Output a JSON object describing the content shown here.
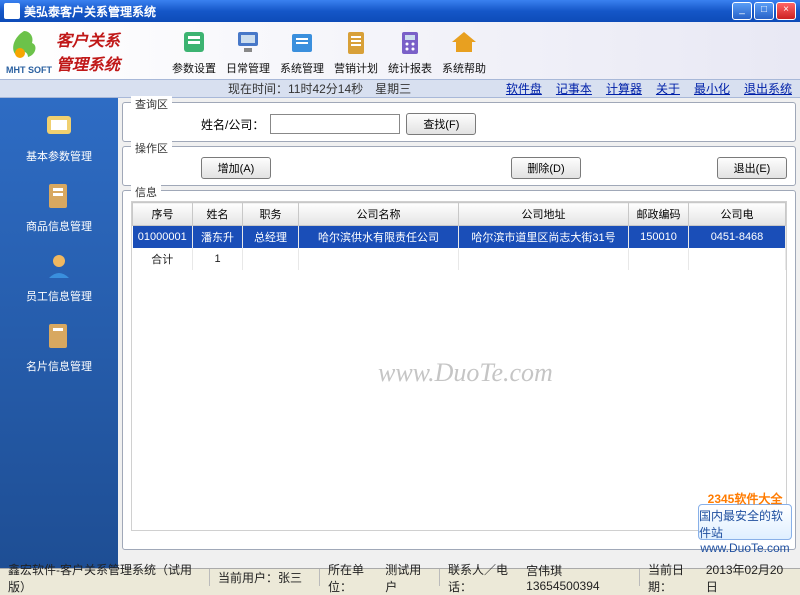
{
  "window": {
    "title": "美弘泰客户关系管理系统"
  },
  "brand": {
    "logotext": "MHT SOFT",
    "line1": "客户关系",
    "line2": "管理系统"
  },
  "ribbon": [
    {
      "label": "参数设置"
    },
    {
      "label": "日常管理"
    },
    {
      "label": "系统管理"
    },
    {
      "label": "营销计划"
    },
    {
      "label": "统计报表"
    },
    {
      "label": "系统帮助"
    }
  ],
  "subbar": {
    "time": "现在时间：11时42分14秒　星期三",
    "links": [
      "软件盘",
      "记事本",
      "计算器",
      "关于",
      "最小化",
      "退出系统"
    ]
  },
  "sidebar": [
    {
      "label": "基本参数管理"
    },
    {
      "label": "商品信息管理"
    },
    {
      "label": "员工信息管理"
    },
    {
      "label": "名片信息管理"
    }
  ],
  "groups": {
    "query": {
      "legend": "查询区",
      "label": "姓名/公司：",
      "value": "",
      "find": "查找(F)"
    },
    "actions": {
      "legend": "操作区",
      "add": "增加(A)",
      "del": "删除(D)",
      "exit": "退出(E)"
    },
    "info": {
      "legend": "信息"
    }
  },
  "table": {
    "headers": [
      "序号",
      "姓名",
      "职务",
      "公司名称",
      "公司地址",
      "邮政编码",
      "公司电"
    ],
    "rows": [
      {
        "cells": [
          "01000001",
          "潘东升",
          "总经理",
          "哈尔滨供水有限责任公司",
          "哈尔滨市道里区尚志大街31号",
          "150010",
          "0451-8468"
        ]
      }
    ],
    "total": {
      "label": "合计",
      "count": "1"
    }
  },
  "watermark": "www.DuoTe.com",
  "badge": {
    "brand": "2345软件大全",
    "slogan": "国内最安全的软件站",
    "url": "www.DuoTe.com"
  },
  "statusbar": {
    "product": "鑫宏软件-客户关系管理系统（试用版）",
    "user_label": "当前用户：",
    "user": "张三",
    "org_label": "所在单位：",
    "org": "测试用户",
    "contact_label": "联系人／电话：",
    "contact": "宫伟琪  13654500394",
    "date_label": "当前日期：",
    "date": "2013年02月20日"
  }
}
